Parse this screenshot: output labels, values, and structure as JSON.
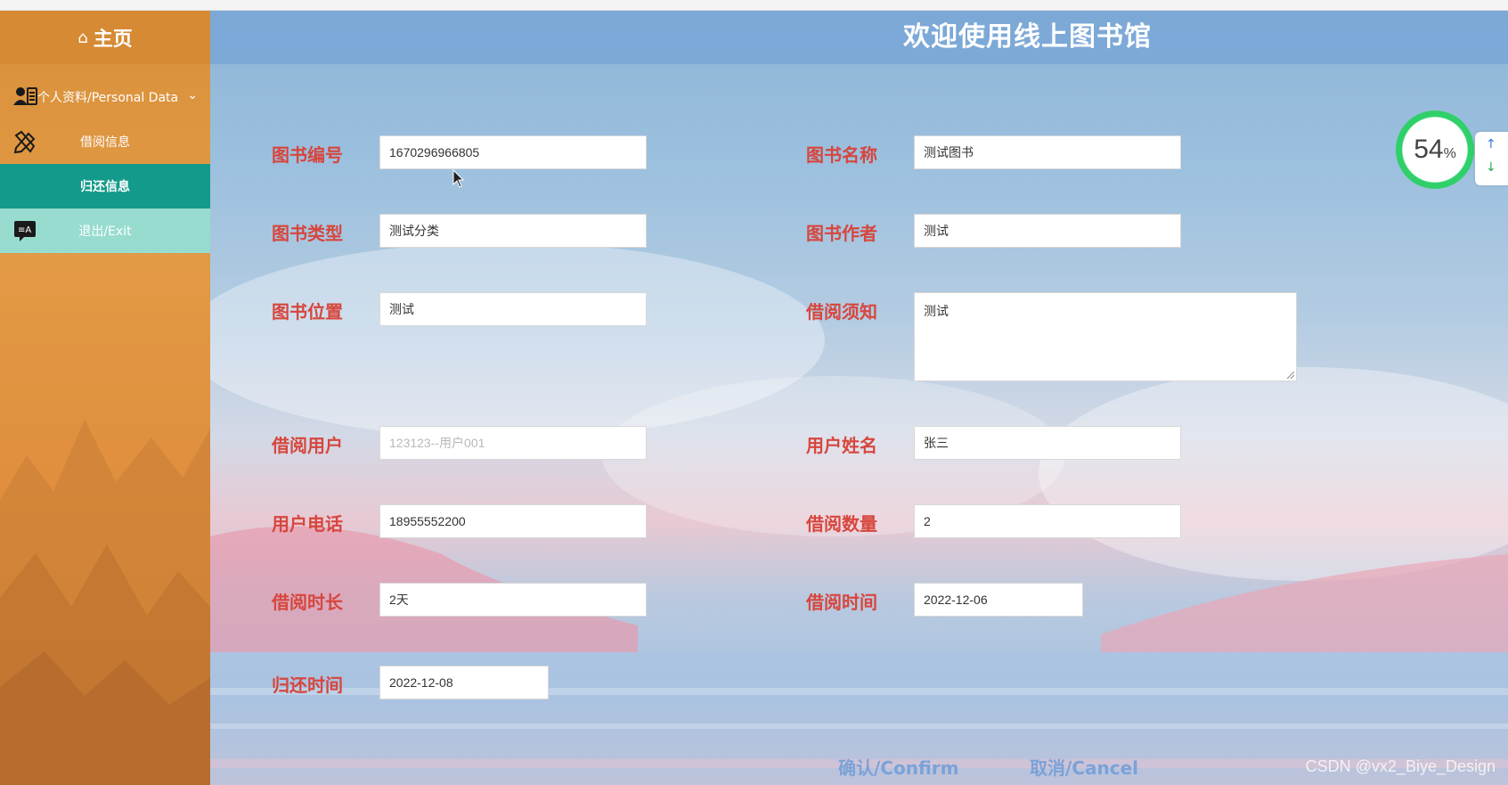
{
  "sidebar": {
    "home_label": "主页",
    "items": [
      {
        "label": "个人资料/Personal Data",
        "icon": "id-card-icon"
      },
      {
        "label": "借阅信息",
        "icon": "pencil-ruler-icon"
      },
      {
        "label": "归还信息",
        "icon": ""
      },
      {
        "label": "退出/Exit",
        "icon": "translate-chat-icon"
      }
    ]
  },
  "header": {
    "title": "欢迎使用线上图书馆"
  },
  "form": {
    "book_no": {
      "label": "图书编号",
      "value": "1670296966805"
    },
    "book_name": {
      "label": "图书名称",
      "value": "测试图书"
    },
    "book_type": {
      "label": "图书类型",
      "value": "测试分类"
    },
    "book_author": {
      "label": "图书作者",
      "value": "测试"
    },
    "book_location": {
      "label": "图书位置",
      "value": "测试"
    },
    "borrow_notice": {
      "label": "借阅须知",
      "value": "测试"
    },
    "borrow_user": {
      "label": "借阅用户",
      "value": "123123--用户001"
    },
    "user_name": {
      "label": "用户姓名",
      "value": "张三"
    },
    "user_phone": {
      "label": "用户电话",
      "value": "18955552200"
    },
    "borrow_count": {
      "label": "借阅数量",
      "value": "2"
    },
    "borrow_duration": {
      "label": "借阅时长",
      "value": "2天"
    },
    "borrow_time": {
      "label": "借阅时间",
      "value": "2022-12-06"
    },
    "return_time": {
      "label": "归还时间",
      "value": "2022-12-08"
    }
  },
  "buttons": {
    "confirm": "确认/Confirm",
    "cancel": "取消/Cancel"
  },
  "progress_widget": {
    "value": "54",
    "unit": "%"
  },
  "watermark": "CSDN @vx2_Biye_Design",
  "colors": {
    "label_red": "#d7463d",
    "sidebar_orange": "#e0923f",
    "active_teal": "#139a8a",
    "exit_mint": "#97dccf",
    "button_blue": "#7aa2d8"
  }
}
